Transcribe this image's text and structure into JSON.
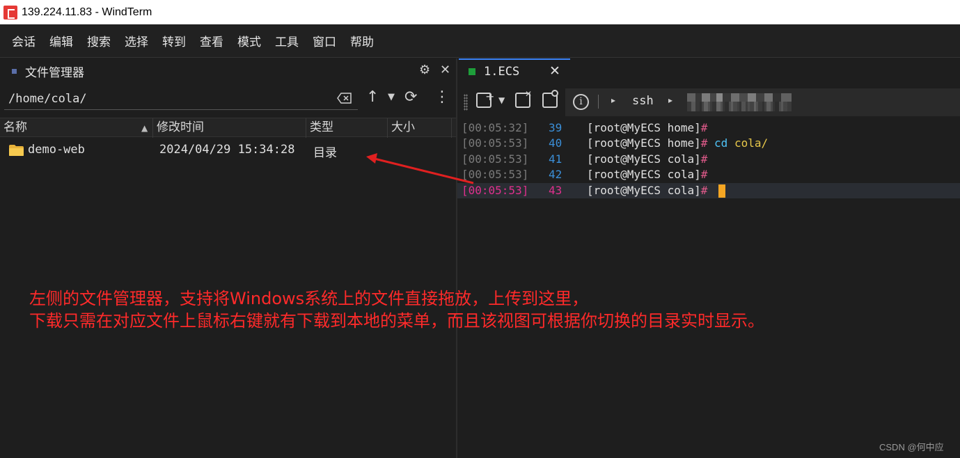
{
  "window": {
    "title": "139.224.11.83 - WindTerm"
  },
  "menu": {
    "items": [
      "会话",
      "编辑",
      "搜索",
      "选择",
      "转到",
      "查看",
      "模式",
      "工具",
      "窗口",
      "帮助"
    ]
  },
  "file_manager": {
    "title": "文件管理器",
    "path": "/home/cola/",
    "columns": {
      "name": "名称",
      "modified": "修改时间",
      "type": "类型",
      "size": "大小"
    },
    "rows": [
      {
        "name": "demo-web",
        "modified": "2024/04/29 15:34:28",
        "type": "目录",
        "size": ""
      }
    ]
  },
  "terminal": {
    "tab_label": "1.ECS",
    "tab_status_color": "#1e9e3a",
    "session_protocol": "ssh",
    "lines": [
      {
        "time": "[00:05:32]",
        "num": "39",
        "prompt": "[root@MyECS home]",
        "hash": "#",
        "cmd_kw": "",
        "cmd_arg": ""
      },
      {
        "time": "[00:05:53]",
        "num": "40",
        "prompt": "[root@MyECS home]",
        "hash": "#",
        "cmd_kw": "cd",
        "cmd_arg": "cola/"
      },
      {
        "time": "[00:05:53]",
        "num": "41",
        "prompt": "[root@MyECS cola]",
        "hash": "#",
        "cmd_kw": "",
        "cmd_arg": ""
      },
      {
        "time": "[00:05:53]",
        "num": "42",
        "prompt": "[root@MyECS cola]",
        "hash": "#",
        "cmd_kw": "",
        "cmd_arg": ""
      },
      {
        "time": "[00:05:53]",
        "num": "43",
        "prompt": "[root@MyECS cola]",
        "hash": "#",
        "cmd_kw": "",
        "cmd_arg": ""
      }
    ]
  },
  "annotation": {
    "line1": "左侧的文件管理器，支持将Windows系统上的文件直接拖放，上传到这里，",
    "line2": "下载只需在对应文件上鼠标右键就有下载到本地的菜单，而且该视图可根据你切换的目录实时显示。",
    "color": "#ff2a2a"
  },
  "watermark": "CSDN @何中应",
  "icons": {
    "app": "windterm-app-icon",
    "gear": "gear-icon",
    "close": "close-icon",
    "clear": "clear-input-icon",
    "up": "arrow-up-icon",
    "refresh": "refresh-icon",
    "more": "more-vertical-icon",
    "folder": "folder-icon",
    "info": "info-icon"
  }
}
